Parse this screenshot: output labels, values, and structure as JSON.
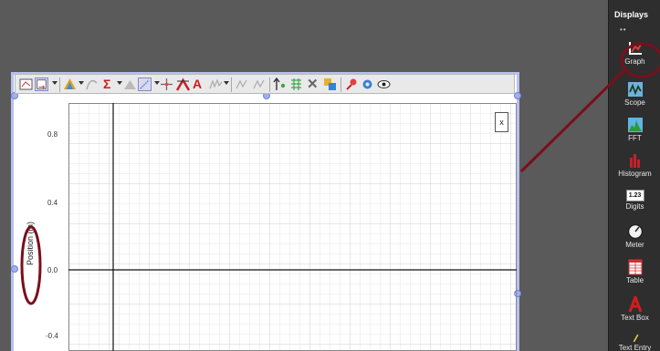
{
  "palette": {
    "title": "Displays",
    "dots": "••",
    "items": [
      {
        "label": "Graph",
        "icon": "graph-icon"
      },
      {
        "label": "Scope",
        "icon": "scope-icon"
      },
      {
        "label": "FFT",
        "icon": "fft-icon"
      },
      {
        "label": "Histogram",
        "icon": "histogram-icon"
      },
      {
        "label": "Digits",
        "icon": "digits-icon",
        "icon_text": "1.23"
      },
      {
        "label": "Meter",
        "icon": "meter-icon"
      },
      {
        "label": "Table",
        "icon": "table-icon"
      },
      {
        "label": "Text Box",
        "icon": "text-box-icon"
      },
      {
        "label": "Text Entry",
        "icon": "text-entry-icon"
      }
    ]
  },
  "graph": {
    "close_label": "x",
    "y_axis_label": "Position (m)",
    "y_ticks": [
      "0.8",
      "0.4",
      "0.0",
      "-0.4"
    ]
  },
  "colors": {
    "annotation": "#7a0f1c",
    "frame_border": "#b7c0f0",
    "palette_bg": "#2e2e2e"
  }
}
